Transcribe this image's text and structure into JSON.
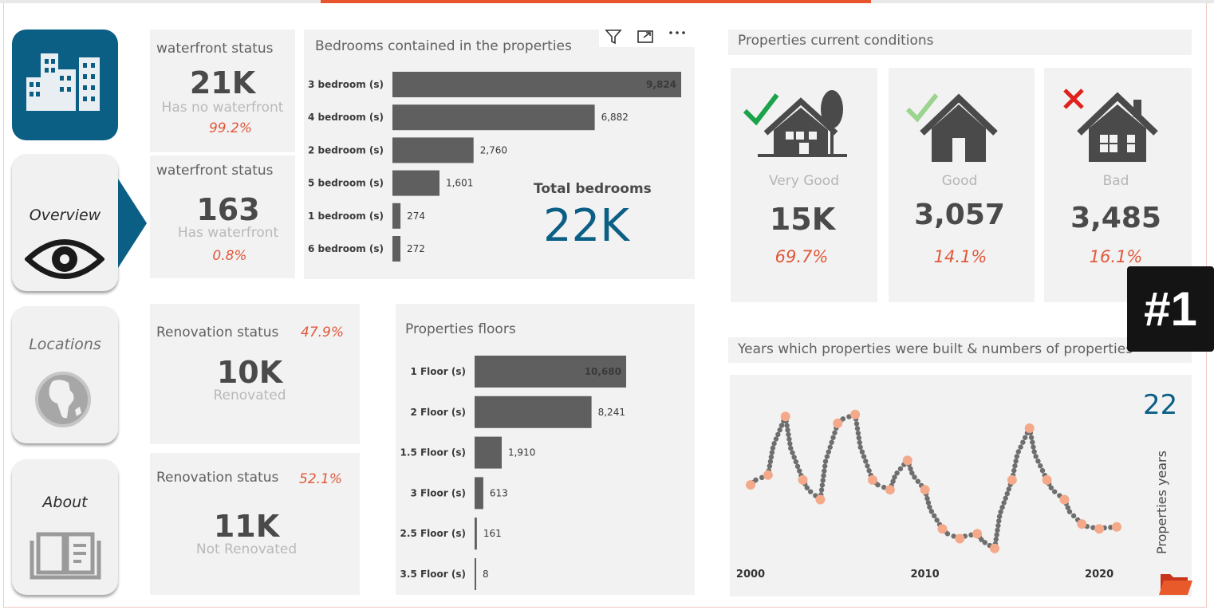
{
  "nav": {
    "logo_icon": "city-buildings-icon",
    "items": [
      {
        "label": "Overview",
        "icon": "eye-icon",
        "active": true
      },
      {
        "label": "Locations",
        "icon": "globe-icon",
        "active": false
      },
      {
        "label": "About",
        "icon": "open-book-icon",
        "active": false
      }
    ]
  },
  "waterfront": [
    {
      "title": "waterfront status",
      "value": "21K",
      "label": "Has no waterfront",
      "pct": "99.2%"
    },
    {
      "title": "waterfront status",
      "value": "163",
      "label": "Has waterfront",
      "pct": "0.8%"
    }
  ],
  "renovation": [
    {
      "title": "Renovation status",
      "pct": "47.9%",
      "value": "10K",
      "label": "Renovated"
    },
    {
      "title": "Renovation status",
      "pct": "52.1%",
      "value": "11K",
      "label": "Not Renovated"
    }
  ],
  "bedrooms": {
    "total_label": "Total bedrooms",
    "total_value": "22K",
    "toolbar": [
      "filter-icon",
      "focus-mode-icon",
      "more-options-icon"
    ]
  },
  "conditions": {
    "title": "Properties current conditions",
    "cards": [
      {
        "label": "Very Good",
        "value": "15K",
        "pct": "69.7%",
        "mark": "check-dark-green"
      },
      {
        "label": "Good",
        "value": "3,057",
        "pct": "14.1%",
        "mark": "check-light-green"
      },
      {
        "label": "Bad",
        "value": "3,485",
        "pct": "16.1%",
        "mark": "cross-red"
      }
    ]
  },
  "years": {
    "title": "Years which properties were built & numbers of properties",
    "count_value": "22",
    "count_label": "Properties years"
  },
  "badge": "#1",
  "colors": {
    "accent": "#0b5f85",
    "bar": "#5f5f5f",
    "pct": "#e0583a",
    "point": "#f4a98a",
    "dots": "#6e6e6e"
  },
  "chart_data": [
    {
      "type": "bar",
      "title": "Bedrooms contained in the properties",
      "categories": [
        "3 bedroom (s)",
        "4 bedroom (s)",
        "2 bedroom (s)",
        "5 bedroom (s)",
        "1 bedroom (s)",
        "6 bedroom (s)"
      ],
      "values": [
        9824,
        6882,
        2760,
        1601,
        274,
        272
      ],
      "value_labels": [
        "9,824",
        "6,882",
        "2,760",
        "1,601",
        "274",
        "272"
      ],
      "orientation": "horizontal"
    },
    {
      "type": "bar",
      "title": "Properties floors",
      "categories": [
        "1 Floor (s)",
        "2 Floor (s)",
        "1.5 Floor (s)",
        "3 Floor (s)",
        "2.5 Floor (s)",
        "3.5 Floor (s)"
      ],
      "values": [
        10680,
        8241,
        1910,
        613,
        161,
        8
      ],
      "value_labels": [
        "10,680",
        "8,241",
        "1,910",
        "613",
        "161",
        "8"
      ],
      "orientation": "horizontal"
    },
    {
      "type": "line",
      "x_ticks": [
        "2000",
        "2010",
        "2020"
      ],
      "x": [
        2000,
        2001,
        2002,
        2003,
        2004,
        2005,
        2006,
        2007,
        2008,
        2009,
        2010,
        2011,
        2012,
        2013,
        2014,
        2015,
        2016,
        2017,
        2018,
        2019,
        2020,
        2021
      ],
      "y": [
        0.25,
        0.35,
        0.95,
        0.3,
        0.1,
        0.88,
        0.97,
        0.3,
        0.2,
        0.5,
        0.2,
        -0.2,
        -0.3,
        -0.25,
        -0.4,
        0.3,
        0.83,
        0.3,
        0.1,
        -0.15,
        -0.2,
        -0.18
      ]
    }
  ]
}
